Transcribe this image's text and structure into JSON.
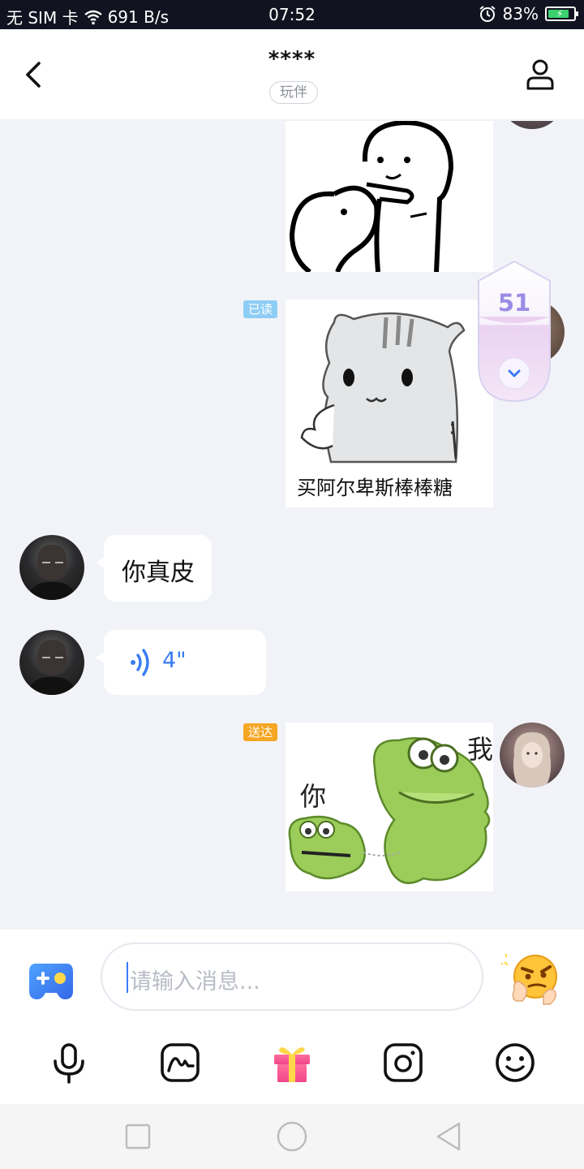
{
  "status_bar": {
    "carrier": "无 SIM 卡",
    "speed": "691 B/s",
    "time": "07:52",
    "battery": "83%",
    "battery_level": 0.83
  },
  "header": {
    "title": "****",
    "tag": "玩伴"
  },
  "messages": {
    "read_badge": "已读",
    "delivered_badge": "送达",
    "sticker_hamster_caption": "买阿尔卑斯棒棒糖",
    "text_message": "你真皮",
    "voice_duration": "4\"",
    "sticker_croc_left": "你",
    "sticker_croc_right": "我"
  },
  "counter": {
    "value": "51"
  },
  "input": {
    "placeholder": "请输入消息..."
  },
  "colors": {
    "accent_blue": "#3a7bf5",
    "read_badge": "#8ecdf5",
    "delivered_badge": "#f5a623",
    "counter_purple": "#9b8ce6"
  },
  "icons": {
    "back": "chevron-left-icon",
    "profile": "user-icon",
    "voice": "voice-wave-icon",
    "mic": "microphone-icon",
    "doodle": "doodle-icon",
    "gift": "gift-icon",
    "camera": "camera-icon",
    "emoji": "smiley-icon"
  }
}
